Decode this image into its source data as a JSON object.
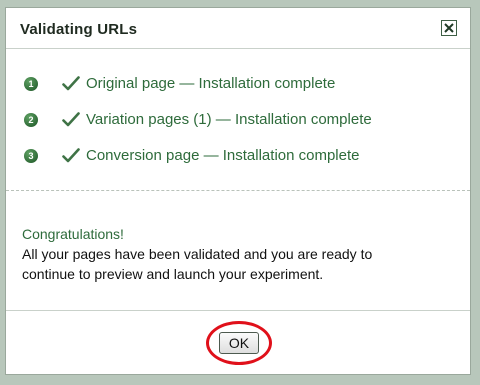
{
  "dialog": {
    "title": "Validating URLs",
    "close_icon": "close-x-icon"
  },
  "steps": [
    {
      "number": "1",
      "label": "Original page — Installation complete",
      "icon": "checkmark-icon"
    },
    {
      "number": "2",
      "label": "Variation pages (1) — Installation complete",
      "icon": "checkmark-icon"
    },
    {
      "number": "3",
      "label": "Conversion page — Installation complete",
      "icon": "checkmark-icon"
    }
  ],
  "message": {
    "title": "Congratulations!",
    "line1": "All your pages have been validated and you are ready to",
    "line2": "continue to preview and launch your experiment."
  },
  "footer": {
    "ok_label": "OK"
  },
  "colors": {
    "accent_green": "#2e6b3b",
    "highlight_red": "#e0101a"
  }
}
